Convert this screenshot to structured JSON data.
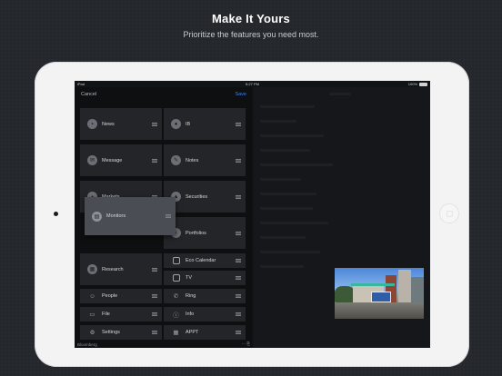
{
  "header": {
    "title": "Make It Yours",
    "subtitle": "Prioritize the features you need most."
  },
  "status_bar": {
    "device": "iPad",
    "time": "5:27 PM",
    "battery": "100%"
  },
  "editor": {
    "cancel_label": "Cancel",
    "save_label": "Save",
    "tiles": {
      "news": "News",
      "ib": "IB",
      "message": "Message",
      "notes": "Notes",
      "markets": "Markets",
      "securities": "Securities",
      "monitors": "Monitors",
      "portfolios": "Portfolios",
      "eco_calendar": "Eco Calendar",
      "research": "Research",
      "tv": "TV",
      "people": "People",
      "ring": "Ring",
      "file": "File",
      "info": "Info",
      "settings": "Settings",
      "appt": "APPT"
    },
    "footer_brand": "Bloomberg"
  },
  "colors": {
    "save_accent": "#3b82f6",
    "tile_bg": "#232529",
    "dragging_tile_bg": "#4a4d53",
    "device_frame": "#f3f3f4",
    "backdrop": "#24282d"
  }
}
